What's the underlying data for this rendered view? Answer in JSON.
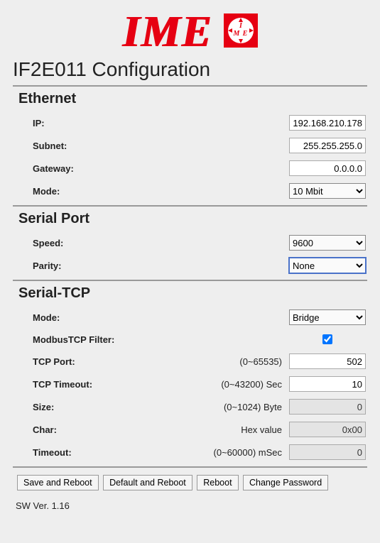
{
  "logo_text": "IME",
  "page_title": "IF2E011 Configuration",
  "groups": {
    "ethernet": {
      "title": "Ethernet",
      "ip_label": "IP:",
      "ip_value": "192.168.210.178",
      "subnet_label": "Subnet:",
      "subnet_value": "255.255.255.0",
      "gateway_label": "Gateway:",
      "gateway_value": "0.0.0.0",
      "mode_label": "Mode:",
      "mode_value": "10 Mbit"
    },
    "serial": {
      "title": "Serial Port",
      "speed_label": "Speed:",
      "speed_value": "9600",
      "parity_label": "Parity:",
      "parity_value": "None"
    },
    "serialtcp": {
      "title": "Serial-TCP",
      "mode_label": "Mode:",
      "mode_value": "Bridge",
      "filter_label": "ModbusTCP Filter:",
      "filter_checked": true,
      "tcpport_label": "TCP Port:",
      "tcpport_hint": "(0~65535)",
      "tcpport_value": "502",
      "tcptimeout_label": "TCP Timeout:",
      "tcptimeout_hint": "(0~43200) Sec",
      "tcptimeout_value": "10",
      "size_label": "Size:",
      "size_hint": "(0~1024) Byte",
      "size_value": "0",
      "char_label": "Char:",
      "char_hint": "Hex value",
      "char_value": "0x00",
      "timeout_label": "Timeout:",
      "timeout_hint": "(0~60000) mSec",
      "timeout_value": "0"
    }
  },
  "buttons": {
    "save_reboot": "Save and Reboot",
    "default_reboot": "Default and Reboot",
    "reboot": "Reboot",
    "change_password": "Change Password"
  },
  "footer": "SW Ver. 1.16"
}
